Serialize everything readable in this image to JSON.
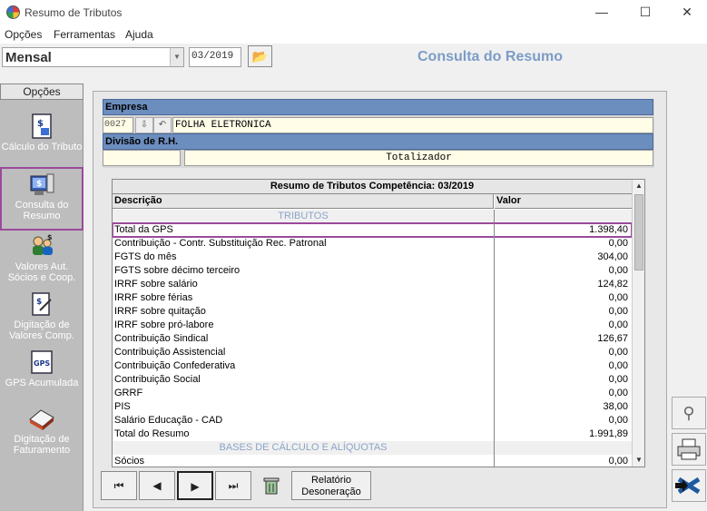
{
  "window": {
    "title": "Resumo de Tributos",
    "minimize": "—",
    "maximize": "☐",
    "close": "✕"
  },
  "menu": [
    "Opções",
    "Ferramentas",
    "Ajuda"
  ],
  "toolbar": {
    "period": "Mensal",
    "date": "03/2019",
    "screen_title": "Consulta do Resumo"
  },
  "sidebar": {
    "header": "Opções",
    "items": [
      {
        "label": "Cálculo do Tributo",
        "icon": "calculator-document-icon",
        "selected": false
      },
      {
        "label": "Consulta do Resumo",
        "icon": "computer-query-icon",
        "selected": true
      },
      {
        "label": "Valores Aut. Sócios e Coop.",
        "icon": "people-money-icon",
        "selected": false
      },
      {
        "label": "Digitação de Valores Comp.",
        "icon": "edit-document-icon",
        "selected": false
      },
      {
        "label": "GPS Acumulada",
        "icon": "gps-document-icon",
        "selected": false
      },
      {
        "label": "Digitação de Faturamento",
        "icon": "printer-invoice-icon",
        "selected": false
      }
    ]
  },
  "company": {
    "label": "Empresa",
    "code": "0027",
    "name": "FOLHA ELETRONICA",
    "division_label": "Divisão de R.H.",
    "division_name": "Totalizador"
  },
  "summary": {
    "title": "Resumo de Tributos Competência: 03/2019",
    "col_desc": "Descrição",
    "col_value": "Valor",
    "rows": [
      {
        "desc": "TRIBUTOS",
        "value": "",
        "section": true
      },
      {
        "desc": "Total da GPS",
        "value": "1.398,40",
        "highlight": true
      },
      {
        "desc": "Contribuição - Contr. Substituição Rec. Patronal",
        "value": "0,00"
      },
      {
        "desc": "FGTS do mês",
        "value": "304,00"
      },
      {
        "desc": "FGTS sobre décimo terceiro",
        "value": "0,00"
      },
      {
        "desc": "IRRF sobre salário",
        "value": "124,82"
      },
      {
        "desc": "IRRF sobre férias",
        "value": "0,00"
      },
      {
        "desc": "IRRF sobre quitação",
        "value": "0,00"
      },
      {
        "desc": "IRRF sobre pró-labore",
        "value": "0,00"
      },
      {
        "desc": "Contribuição Sindical",
        "value": "126,67"
      },
      {
        "desc": "Contribuição Assistencial",
        "value": "0,00"
      },
      {
        "desc": "Contribuição Confederativa",
        "value": "0,00"
      },
      {
        "desc": "Contribuição Social",
        "value": "0,00"
      },
      {
        "desc": "GRRF",
        "value": "0,00"
      },
      {
        "desc": "PIS",
        "value": "38,00"
      },
      {
        "desc": "Salário Educação - CAD",
        "value": "0,00"
      },
      {
        "desc": "Total do Resumo",
        "value": "1.991,89"
      },
      {
        "desc": "BASES DE CÁLCULO E ALÍQUOTAS",
        "value": "",
        "section": true
      },
      {
        "desc": "Sócios",
        "value": "0,00"
      }
    ]
  },
  "nav": {
    "first": "⏮",
    "prev": "◀",
    "next": "▶",
    "last": "⏭",
    "report": "Relatório Desoneração"
  },
  "right_tools": [
    "search-people-icon",
    "printer-icon",
    "exit-icon"
  ]
}
